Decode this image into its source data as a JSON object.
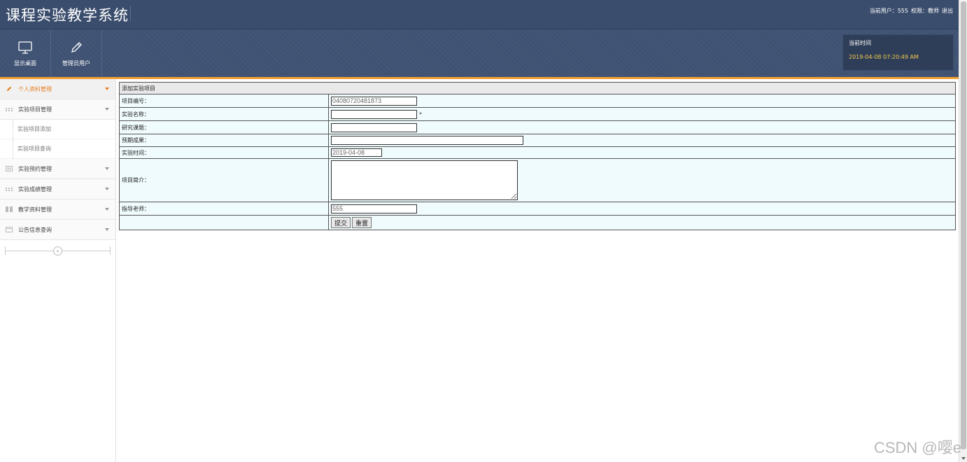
{
  "app": {
    "title": "课程实验教学系统"
  },
  "user_info": {
    "current_user": "当前用户：555",
    "role": "权限：教师",
    "logout": "退出"
  },
  "nav": [
    {
      "label": "显示桌面",
      "icon": "monitor-icon"
    },
    {
      "label": "管理员用户",
      "icon": "pencil-icon"
    }
  ],
  "time": {
    "label": "当前时间",
    "value": "2019-04-08 07:20:49 AM"
  },
  "sidebar": {
    "items": [
      {
        "label": "个人资料管理",
        "icon": "pencil-icon",
        "active": true
      },
      {
        "label": "实验项目管理",
        "icon": "grid-icon"
      },
      {
        "label": "实验项目添加",
        "sub": true
      },
      {
        "label": "实验项目查询",
        "sub": true
      },
      {
        "label": "实验预约管理",
        "icon": "list-icon"
      },
      {
        "label": "实验成绩管理",
        "icon": "grid-icon"
      },
      {
        "label": "教学资料管理",
        "icon": "book-icon"
      },
      {
        "label": "公告信息查询",
        "icon": "calendar-icon"
      }
    ],
    "collapse_glyph": "‹"
  },
  "form": {
    "title": "添加实验项目",
    "fields": {
      "project_no": {
        "label": "项目编号：",
        "value": "04080720481873"
      },
      "project_name": {
        "label": "实验名称：",
        "value": "",
        "required_mark": "*"
      },
      "research_topic": {
        "label": "研究课题：",
        "value": ""
      },
      "expected_result": {
        "label": "预期成果：",
        "value": ""
      },
      "exp_time": {
        "label": "实验时间：",
        "value": "2019-04-08"
      },
      "intro": {
        "label": "项目简介：",
        "value": ""
      },
      "teacher": {
        "label": "指导老师：",
        "value": "555"
      }
    },
    "submit_label": "提交",
    "reset_label": "重置"
  },
  "watermark": "CSDN @嘤e"
}
